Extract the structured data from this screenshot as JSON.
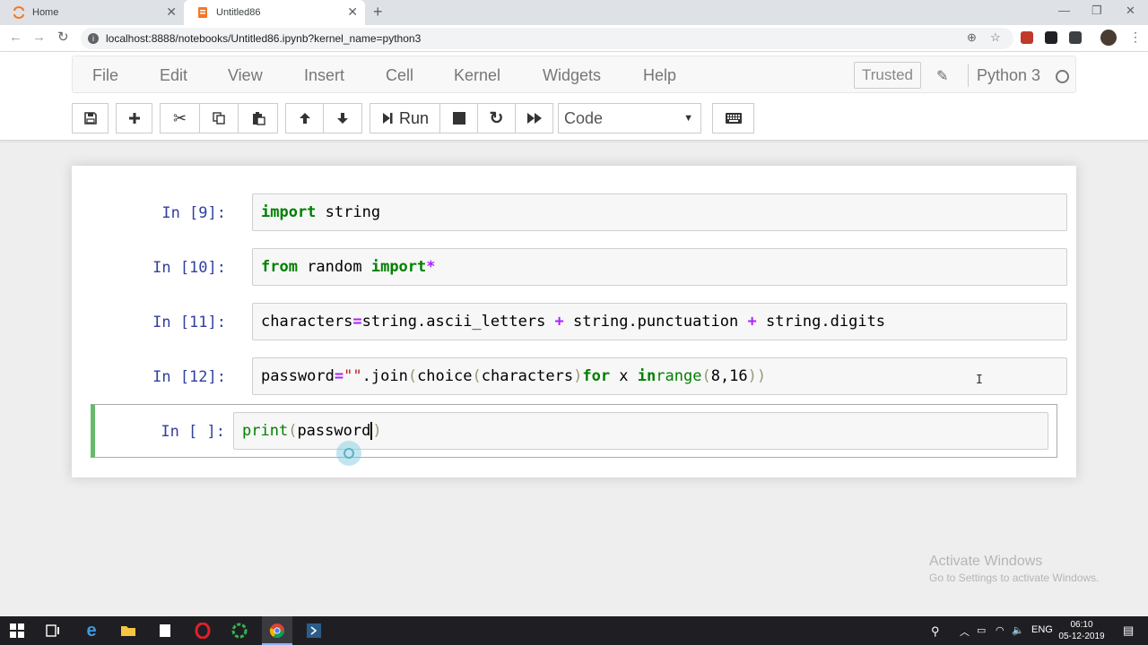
{
  "browser": {
    "tabs": [
      {
        "title": "Home",
        "icon": "jupyter-favicon-icon"
      },
      {
        "title": "Untitled86",
        "icon": "notebook-favicon-icon"
      }
    ],
    "url": "localhost:8888/notebooks/Untitled86.ipynb?kernel_name=python3"
  },
  "menubar": {
    "items": [
      "File",
      "Edit",
      "View",
      "Insert",
      "Cell",
      "Kernel",
      "Widgets",
      "Help"
    ],
    "trusted": "Trusted",
    "kernel": "Python 3"
  },
  "toolbar": {
    "run_label": "Run",
    "cell_type": "Code"
  },
  "cells": [
    {
      "prompt": "In [9]:",
      "code": "import string"
    },
    {
      "prompt": "In [10]:",
      "code": "from random import *"
    },
    {
      "prompt": "In [11]:",
      "code": "characters=string.ascii_letters + string.punctuation + string.digits"
    },
    {
      "prompt": "In [12]:",
      "code": "password=\"\".join(choice(characters) for x in range(8,16))"
    },
    {
      "prompt": "In [ ]:",
      "code": "print(password)"
    }
  ],
  "watermark": {
    "line1": "Activate Windows",
    "line2": "Go to Settings to activate Windows."
  },
  "taskbar": {
    "lang": "ENG",
    "time": "06:10",
    "date": "05-12-2019"
  },
  "colors": {
    "selected_cell_border": "#66bb6a",
    "prompt": "#303f9f",
    "keyword": "#008000",
    "operator": "#aa22ff",
    "string": "#ba2121"
  }
}
